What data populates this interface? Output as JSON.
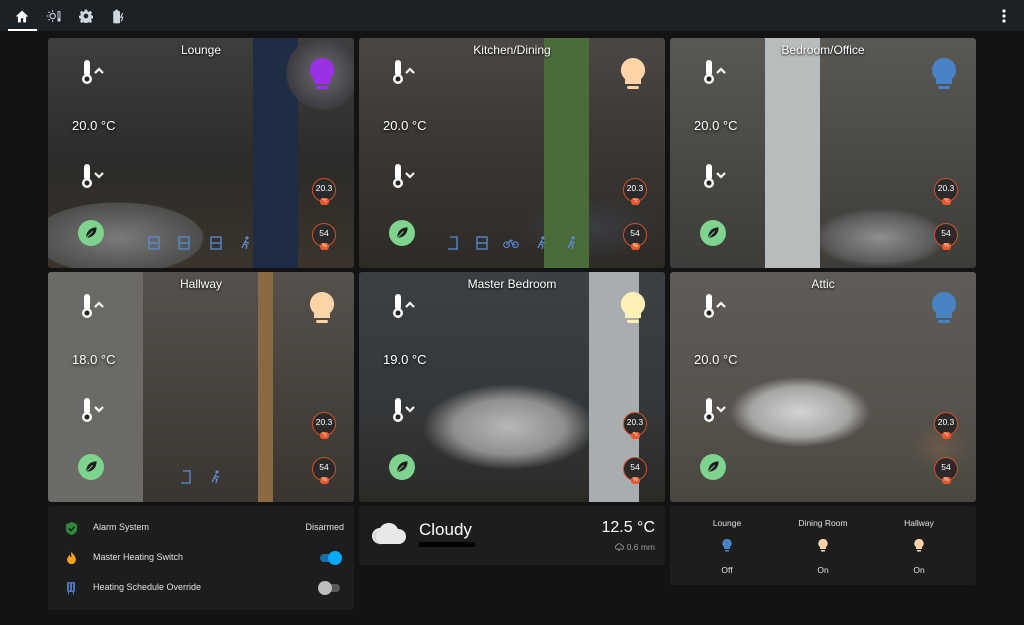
{
  "topbar": {
    "icons": [
      "home-icon",
      "sun-thermostat-icon",
      "gear-icon",
      "battery-charging-icon",
      "more-vertical-icon"
    ]
  },
  "rooms": [
    {
      "name": "Lounge",
      "temperature": "20.0 °C",
      "bulb_color": "#9b30e6",
      "badge_temp": "20.3",
      "badge_humidity": "54"
    },
    {
      "name": "Kitchen/Dining",
      "temperature": "20.0 °C",
      "bulb_color": "#ffd3a8",
      "badge_temp": "20.3",
      "badge_humidity": "54"
    },
    {
      "name": "Bedroom/Office",
      "temperature": "20.0 °C",
      "bulb_color": "#4884c4",
      "badge_temp": "20.3",
      "badge_humidity": "54"
    },
    {
      "name": "Hallway",
      "temperature": "18.0 °C",
      "bulb_color": "#ffd3a8",
      "badge_temp": "20.3",
      "badge_humidity": "54"
    },
    {
      "name": "Master Bedroom",
      "temperature": "19.0 °C",
      "bulb_color": "#fff0b8",
      "badge_temp": "20.3",
      "badge_humidity": "54"
    },
    {
      "name": "Attic",
      "temperature": "20.0 °C",
      "bulb_color": "#4884c4",
      "badge_temp": "20.3",
      "badge_humidity": "54"
    }
  ],
  "entities": [
    {
      "name": "Alarm System",
      "state": "Disarmed",
      "icon": "shield-check-icon"
    },
    {
      "name": "Master Heating Switch",
      "toggle_on": true,
      "icon": "fire-icon"
    },
    {
      "name": "Heating Schedule Override",
      "toggle_on": false,
      "icon": "radiator-icon"
    }
  ],
  "weather": {
    "condition": "Cloudy",
    "temperature": "12.5 °C",
    "precipitation": "0.6 mm",
    "icon": "cloud-icon"
  },
  "lights": [
    {
      "name": "Lounge",
      "state": "Off",
      "color": "#4884c4"
    },
    {
      "name": "Dining Room",
      "state": "On",
      "color": "#ffd3a8"
    },
    {
      "name": "Hallway",
      "state": "On",
      "color": "#ffd3a8"
    }
  ],
  "colors": {
    "topbar": "#1c2126",
    "card": "#1d1d1d",
    "accent": "#03a9f4",
    "leaf_green": "#7ed38e",
    "badge_ring": "#d2502c"
  }
}
